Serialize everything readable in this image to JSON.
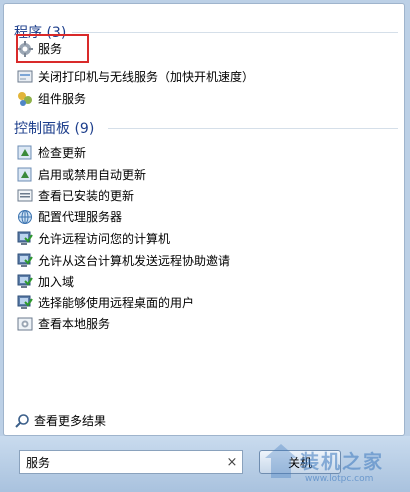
{
  "programs": {
    "header": "程序 (3)",
    "items": [
      {
        "label": "服务",
        "icon": "services-gear-icon"
      },
      {
        "label": "关闭打印机与无线服务（加快开机速度）",
        "icon": "printer-wireless-icon"
      },
      {
        "label": "组件服务",
        "icon": "component-services-icon"
      }
    ]
  },
  "control_panel": {
    "header": "控制面板 (9)",
    "items": [
      {
        "label": "检查更新",
        "icon": "windows-update-icon"
      },
      {
        "label": "启用或禁用自动更新",
        "icon": "windows-update-icon"
      },
      {
        "label": "查看已安装的更新",
        "icon": "installed-updates-icon"
      },
      {
        "label": "配置代理服务器",
        "icon": "proxy-globe-icon"
      },
      {
        "label": "允许远程访问您的计算机",
        "icon": "remote-computer-icon"
      },
      {
        "label": "允许从这台计算机发送远程协助邀请",
        "icon": "remote-computer-icon"
      },
      {
        "label": "加入域",
        "icon": "remote-computer-icon"
      },
      {
        "label": "选择能够使用远程桌面的用户",
        "icon": "remote-computer-icon"
      },
      {
        "label": "查看本地服务",
        "icon": "local-services-icon"
      }
    ]
  },
  "see_more": "查看更多结果",
  "search": {
    "value": "服务"
  },
  "shutdown_label": "关机",
  "watermark": {
    "text": "装机之家",
    "url": "www.lotpc.com"
  },
  "colors": {
    "header": "#1e3f8c",
    "highlight_box": "#d92a2a",
    "taskbar": "#bcd0e6"
  }
}
